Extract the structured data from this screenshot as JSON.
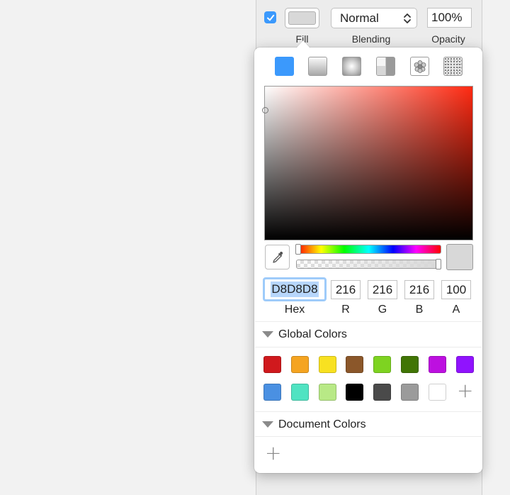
{
  "fill_row": {
    "checkbox_checked": true,
    "fill_color": "#d8d8d8",
    "blending_value": "Normal",
    "opacity_value": "100%",
    "labels": {
      "fill": "Fill",
      "blending": "Blending",
      "opacity": "Opacity"
    }
  },
  "fill_types": [
    {
      "name": "solid-color",
      "selected": true
    },
    {
      "name": "linear-gradient",
      "selected": false
    },
    {
      "name": "radial-gradient",
      "selected": false
    },
    {
      "name": "angular-gradient",
      "selected": false
    },
    {
      "name": "pattern-fill",
      "selected": false
    },
    {
      "name": "noise-fill",
      "selected": false
    }
  ],
  "picker": {
    "hue_color": "#ff2a12",
    "current_color": "#d8d8d8"
  },
  "values": {
    "hex": "D8D8D8",
    "r": "216",
    "g": "216",
    "b": "216",
    "a": "100",
    "labels": {
      "hex": "Hex",
      "r": "R",
      "g": "G",
      "b": "B",
      "a": "A"
    }
  },
  "global_colors": {
    "title": "Global Colors",
    "swatches": [
      "#d0191d",
      "#f5a421",
      "#f8e121",
      "#8b572a",
      "#7ed321",
      "#417505",
      "#bd10e0",
      "#9013fe",
      "#4a90e2",
      "#50e3c2",
      "#b8e986",
      "#000000",
      "#4a4a4a",
      "#9b9b9b",
      "#ffffff"
    ]
  },
  "document_colors": {
    "title": "Document Colors"
  }
}
